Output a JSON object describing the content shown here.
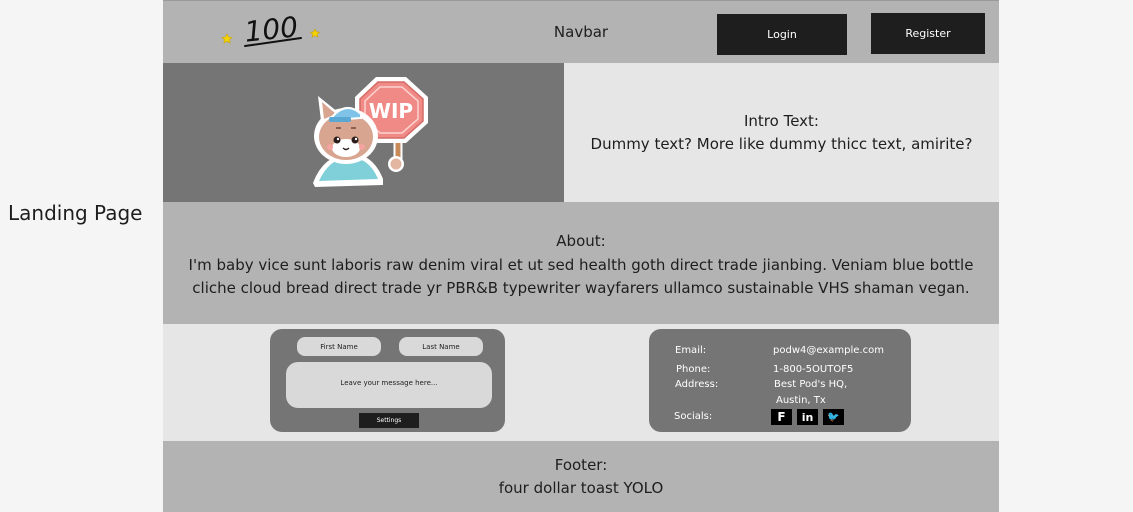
{
  "page_label": "Landing Page",
  "navbar": {
    "logo_text": "100",
    "title": "Navbar",
    "login_label": "Login",
    "register_label": "Register"
  },
  "hero": {
    "sticker_text": "WIP",
    "intro_title": "Intro Text:",
    "intro_body": "Dummy text? More like dummy thicc text, amirite?"
  },
  "about": {
    "title": "About:",
    "body": "I'm baby vice sunt laboris raw denim viral et ut sed health goth direct trade jianbing. Veniam blue bottle cliche cloud bread direct trade yr PBR&B typewriter wayfarers ullamco sustainable VHS shaman vegan."
  },
  "contact_form": {
    "first_name_placeholder": "First Name",
    "last_name_placeholder": "Last Name",
    "message_placeholder": "Leave your message here...",
    "submit_label": "Settings"
  },
  "contact_info": {
    "email_label": "Email:",
    "email_value": "podw4@example.com",
    "phone_label": "Phone:",
    "phone_value": "1-800-5OUTOF5",
    "address_label": "Address:",
    "address_line1": "Best Pod's HQ,",
    "address_line2": "Austin, Tx",
    "socials_label": "Socials:",
    "socials": [
      {
        "icon": "facebook-icon",
        "glyph": "F"
      },
      {
        "icon": "linkedin-icon",
        "glyph": "in"
      },
      {
        "icon": "twitter-icon",
        "glyph": "🐦"
      }
    ]
  },
  "footer": {
    "title": "Footer:",
    "body": "four dollar toast YOLO"
  },
  "colors": {
    "frame_gray": "#b3b3b3",
    "light_gray": "#e6e6e6",
    "dark_gray": "#757575",
    "button_dark": "#1e1e1e",
    "stop_sign": "#f08a86"
  }
}
